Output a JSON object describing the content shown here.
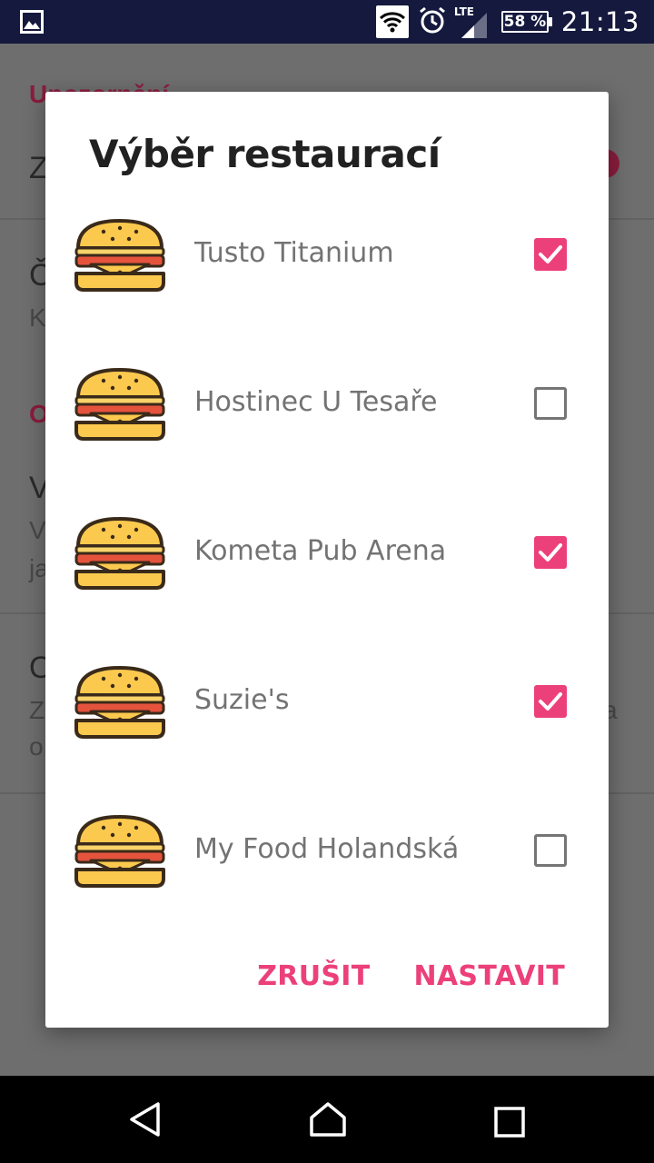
{
  "status_bar": {
    "time": "21:13",
    "battery": "58 %",
    "network": "LTE",
    "icons": [
      "image-icon",
      "wifi-icon",
      "alarm-icon",
      "signal-icon",
      "battery-icon"
    ]
  },
  "background": {
    "category_1": "Upozornění",
    "row_1_title": "Z",
    "row_2_title": "Č",
    "row_2_sub": "K",
    "category_2": "O",
    "row_3_title": "V",
    "row_3_sub_1": "V",
    "row_3_sub_2": "ja",
    "row_4_title": "O",
    "row_4_sub_1": "Z",
    "row_4_sub_1_end": "a",
    "row_4_sub_2": "o"
  },
  "dialog": {
    "title": "Výběr restaurací",
    "items": [
      {
        "label": "Tusto Titanium",
        "checked": true
      },
      {
        "label": "Hostinec U Tesaře",
        "checked": false
      },
      {
        "label": "Kometa Pub Arena",
        "checked": true
      },
      {
        "label": "Suzie's",
        "checked": true
      },
      {
        "label": "My Food Holandská",
        "checked": false
      }
    ],
    "cancel_label": "ZRUŠIT",
    "confirm_label": "NASTAVIT"
  },
  "colors": {
    "accent": "#ec407a",
    "status_bar": "#14193d",
    "category": "#8a1d3e"
  }
}
